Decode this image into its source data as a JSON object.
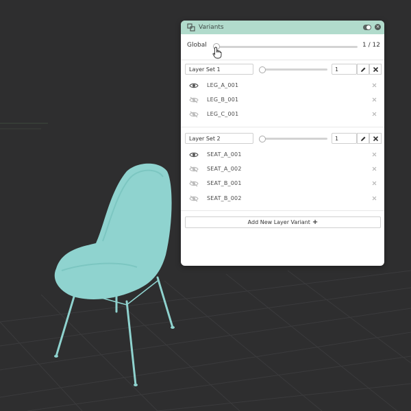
{
  "panel": {
    "title": "Variants",
    "global_label": "Global",
    "global_count": "1 / 12",
    "global_progress": 0.0
  },
  "layer_sets": [
    {
      "name": "Layer Set 1",
      "number": "1",
      "variants": [
        {
          "label": "LEG_A_001",
          "visible": true
        },
        {
          "label": "LEG_B_001",
          "visible": false
        },
        {
          "label": "LEG_C_001",
          "visible": false
        }
      ]
    },
    {
      "name": "Layer Set 2",
      "number": "1",
      "variants": [
        {
          "label": "SEAT_A_001",
          "visible": true
        },
        {
          "label": "SEAT_A_002",
          "visible": false
        },
        {
          "label": "SEAT_B_001",
          "visible": false
        },
        {
          "label": "SEAT_B_002",
          "visible": false
        }
      ]
    }
  ],
  "add_button_label": "Add New Layer Variant",
  "icons": {
    "title": "variants-icon",
    "toggle": "toggle-switch-icon",
    "close": "close-icon",
    "edit": "pencil-icon",
    "delete": "close-icon",
    "visible": "eye-icon",
    "hidden": "eye-slash-icon",
    "add": "plus-icon",
    "cursor": "hand-pointer-icon"
  },
  "colors": {
    "accent": "#b1dbcc",
    "chair": "#8fd3cf",
    "background": "#2e2e2f"
  }
}
